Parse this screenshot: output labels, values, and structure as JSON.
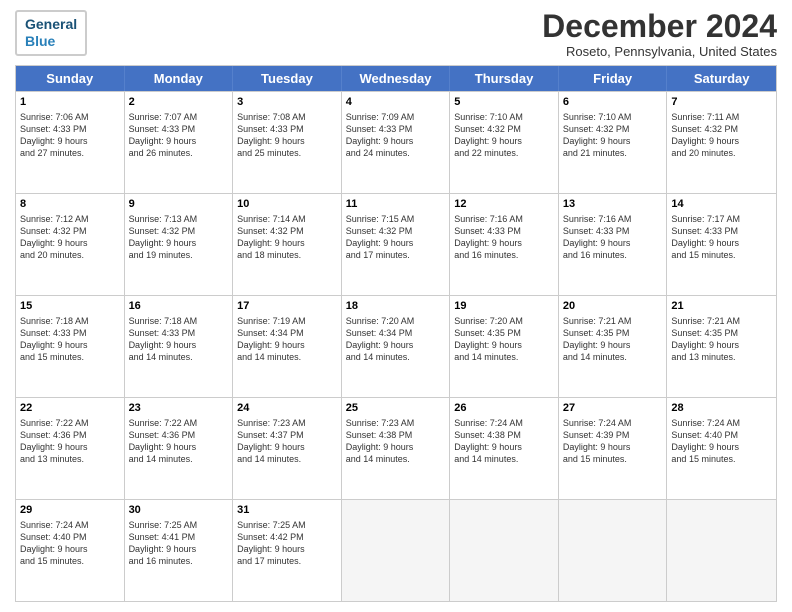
{
  "header": {
    "logo_line1": "General",
    "logo_line2": "Blue",
    "title": "December 2024",
    "location": "Roseto, Pennsylvania, United States"
  },
  "days_of_week": [
    "Sunday",
    "Monday",
    "Tuesday",
    "Wednesday",
    "Thursday",
    "Friday",
    "Saturday"
  ],
  "weeks": [
    [
      {
        "num": "1",
        "lines": [
          "Sunrise: 7:06 AM",
          "Sunset: 4:33 PM",
          "Daylight: 9 hours",
          "and 27 minutes."
        ]
      },
      {
        "num": "2",
        "lines": [
          "Sunrise: 7:07 AM",
          "Sunset: 4:33 PM",
          "Daylight: 9 hours",
          "and 26 minutes."
        ]
      },
      {
        "num": "3",
        "lines": [
          "Sunrise: 7:08 AM",
          "Sunset: 4:33 PM",
          "Daylight: 9 hours",
          "and 25 minutes."
        ]
      },
      {
        "num": "4",
        "lines": [
          "Sunrise: 7:09 AM",
          "Sunset: 4:33 PM",
          "Daylight: 9 hours",
          "and 24 minutes."
        ]
      },
      {
        "num": "5",
        "lines": [
          "Sunrise: 7:10 AM",
          "Sunset: 4:32 PM",
          "Daylight: 9 hours",
          "and 22 minutes."
        ]
      },
      {
        "num": "6",
        "lines": [
          "Sunrise: 7:10 AM",
          "Sunset: 4:32 PM",
          "Daylight: 9 hours",
          "and 21 minutes."
        ]
      },
      {
        "num": "7",
        "lines": [
          "Sunrise: 7:11 AM",
          "Sunset: 4:32 PM",
          "Daylight: 9 hours",
          "and 20 minutes."
        ]
      }
    ],
    [
      {
        "num": "8",
        "lines": [
          "Sunrise: 7:12 AM",
          "Sunset: 4:32 PM",
          "Daylight: 9 hours",
          "and 20 minutes."
        ]
      },
      {
        "num": "9",
        "lines": [
          "Sunrise: 7:13 AM",
          "Sunset: 4:32 PM",
          "Daylight: 9 hours",
          "and 19 minutes."
        ]
      },
      {
        "num": "10",
        "lines": [
          "Sunrise: 7:14 AM",
          "Sunset: 4:32 PM",
          "Daylight: 9 hours",
          "and 18 minutes."
        ]
      },
      {
        "num": "11",
        "lines": [
          "Sunrise: 7:15 AM",
          "Sunset: 4:32 PM",
          "Daylight: 9 hours",
          "and 17 minutes."
        ]
      },
      {
        "num": "12",
        "lines": [
          "Sunrise: 7:16 AM",
          "Sunset: 4:33 PM",
          "Daylight: 9 hours",
          "and 16 minutes."
        ]
      },
      {
        "num": "13",
        "lines": [
          "Sunrise: 7:16 AM",
          "Sunset: 4:33 PM",
          "Daylight: 9 hours",
          "and 16 minutes."
        ]
      },
      {
        "num": "14",
        "lines": [
          "Sunrise: 7:17 AM",
          "Sunset: 4:33 PM",
          "Daylight: 9 hours",
          "and 15 minutes."
        ]
      }
    ],
    [
      {
        "num": "15",
        "lines": [
          "Sunrise: 7:18 AM",
          "Sunset: 4:33 PM",
          "Daylight: 9 hours",
          "and 15 minutes."
        ]
      },
      {
        "num": "16",
        "lines": [
          "Sunrise: 7:18 AM",
          "Sunset: 4:33 PM",
          "Daylight: 9 hours",
          "and 14 minutes."
        ]
      },
      {
        "num": "17",
        "lines": [
          "Sunrise: 7:19 AM",
          "Sunset: 4:34 PM",
          "Daylight: 9 hours",
          "and 14 minutes."
        ]
      },
      {
        "num": "18",
        "lines": [
          "Sunrise: 7:20 AM",
          "Sunset: 4:34 PM",
          "Daylight: 9 hours",
          "and 14 minutes."
        ]
      },
      {
        "num": "19",
        "lines": [
          "Sunrise: 7:20 AM",
          "Sunset: 4:35 PM",
          "Daylight: 9 hours",
          "and 14 minutes."
        ]
      },
      {
        "num": "20",
        "lines": [
          "Sunrise: 7:21 AM",
          "Sunset: 4:35 PM",
          "Daylight: 9 hours",
          "and 14 minutes."
        ]
      },
      {
        "num": "21",
        "lines": [
          "Sunrise: 7:21 AM",
          "Sunset: 4:35 PM",
          "Daylight: 9 hours",
          "and 13 minutes."
        ]
      }
    ],
    [
      {
        "num": "22",
        "lines": [
          "Sunrise: 7:22 AM",
          "Sunset: 4:36 PM",
          "Daylight: 9 hours",
          "and 13 minutes."
        ]
      },
      {
        "num": "23",
        "lines": [
          "Sunrise: 7:22 AM",
          "Sunset: 4:36 PM",
          "Daylight: 9 hours",
          "and 14 minutes."
        ]
      },
      {
        "num": "24",
        "lines": [
          "Sunrise: 7:23 AM",
          "Sunset: 4:37 PM",
          "Daylight: 9 hours",
          "and 14 minutes."
        ]
      },
      {
        "num": "25",
        "lines": [
          "Sunrise: 7:23 AM",
          "Sunset: 4:38 PM",
          "Daylight: 9 hours",
          "and 14 minutes."
        ]
      },
      {
        "num": "26",
        "lines": [
          "Sunrise: 7:24 AM",
          "Sunset: 4:38 PM",
          "Daylight: 9 hours",
          "and 14 minutes."
        ]
      },
      {
        "num": "27",
        "lines": [
          "Sunrise: 7:24 AM",
          "Sunset: 4:39 PM",
          "Daylight: 9 hours",
          "and 15 minutes."
        ]
      },
      {
        "num": "28",
        "lines": [
          "Sunrise: 7:24 AM",
          "Sunset: 4:40 PM",
          "Daylight: 9 hours",
          "and 15 minutes."
        ]
      }
    ],
    [
      {
        "num": "29",
        "lines": [
          "Sunrise: 7:24 AM",
          "Sunset: 4:40 PM",
          "Daylight: 9 hours",
          "and 15 minutes."
        ]
      },
      {
        "num": "30",
        "lines": [
          "Sunrise: 7:25 AM",
          "Sunset: 4:41 PM",
          "Daylight: 9 hours",
          "and 16 minutes."
        ]
      },
      {
        "num": "31",
        "lines": [
          "Sunrise: 7:25 AM",
          "Sunset: 4:42 PM",
          "Daylight: 9 hours",
          "and 17 minutes."
        ]
      },
      null,
      null,
      null,
      null
    ]
  ]
}
